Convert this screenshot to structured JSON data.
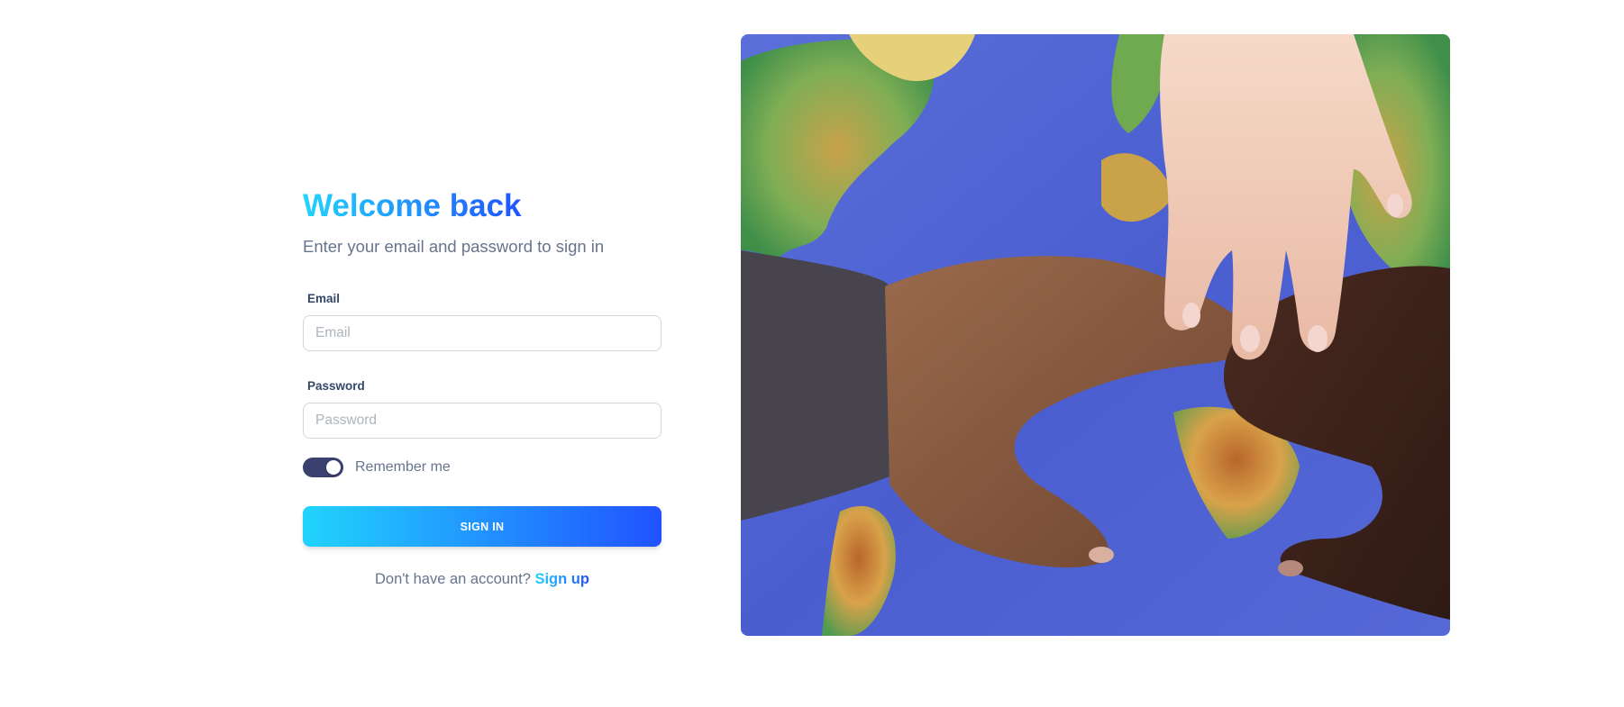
{
  "login": {
    "title": "Welcome back",
    "subtitle": "Enter your email and password to sign in",
    "email_label": "Email",
    "email_placeholder": "Email",
    "email_value": "",
    "password_label": "Password",
    "password_placeholder": "Password",
    "password_value": "",
    "remember_label": "Remember me",
    "remember_checked": true,
    "signin_label": "SIGN IN",
    "signup_prompt": "Don't have an account?",
    "signup_link": "Sign up"
  },
  "hero_image": {
    "description_icon": "hands-on-world-map-image"
  },
  "colors": {
    "gradient_start": "#21d4fd",
    "gradient_end": "#2152ff",
    "text_muted": "#67748e",
    "label_dark": "#344767",
    "toggle_on": "#3a416f"
  }
}
